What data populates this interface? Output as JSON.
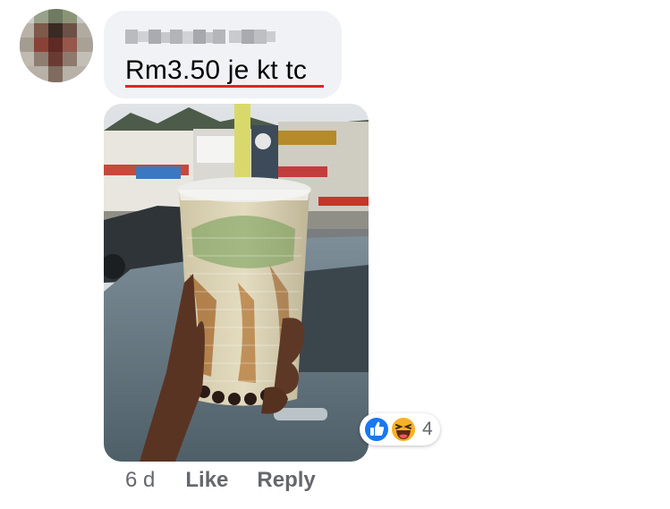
{
  "comment": {
    "author": "",
    "text": "Rm3.50 je kt tc"
  },
  "photo": {
    "description_icon": "photo-image"
  },
  "reactions": {
    "icons": [
      "like-icon",
      "haha-icon"
    ],
    "count": "4"
  },
  "actions": {
    "time": "6 d",
    "like_label": "Like",
    "reply_label": "Reply"
  },
  "colors": {
    "bubble": "#f0f2f5",
    "secondary_text": "#65676b",
    "like_blue": "#1877f2",
    "haha_yellow": "#f7b125",
    "spellcheck_red": "#e02424"
  }
}
